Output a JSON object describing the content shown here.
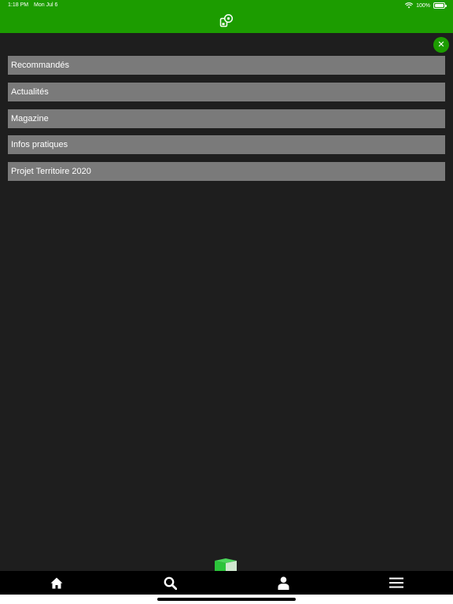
{
  "status_bar": {
    "time": "1:18 PM",
    "date": "Mon Jul 6",
    "battery": "100%"
  },
  "header": {
    "logo_icon": "app-logo-icon",
    "background_color": "#1c9c00"
  },
  "close_button": {
    "icon": "close-icon",
    "symbol": "✕"
  },
  "menu": {
    "items": [
      {
        "label": "Recommandés"
      },
      {
        "label": "Actualités"
      },
      {
        "label": "Magazine"
      },
      {
        "label": "Infos pratiques"
      },
      {
        "label": "Projet Territoire 2020"
      }
    ]
  },
  "tab_bar": {
    "tabs": [
      {
        "icon": "home-icon"
      },
      {
        "icon": "search-icon"
      },
      {
        "icon": "profile-icon"
      },
      {
        "icon": "menu-icon"
      }
    ]
  },
  "colors": {
    "accent": "#1c9c00",
    "background": "#1e1e1e",
    "menu_item": "#7a7a7a",
    "tab_bar": "#000000"
  }
}
